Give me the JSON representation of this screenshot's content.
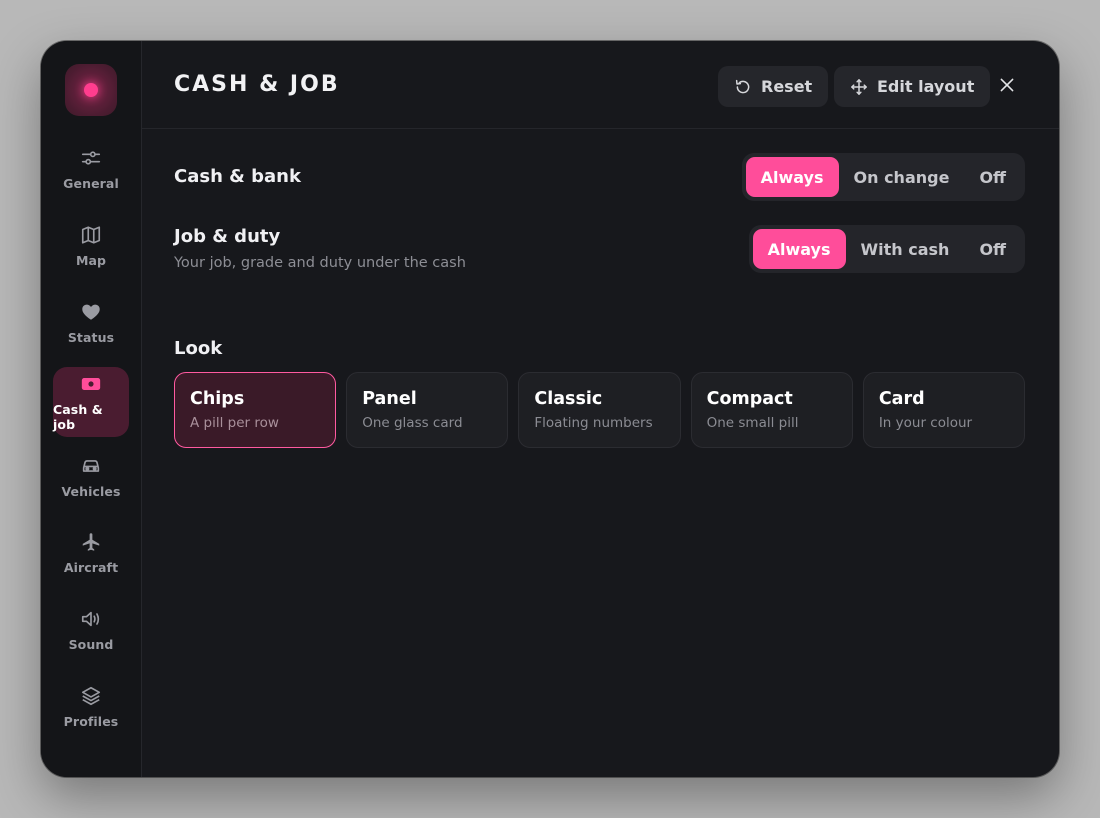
{
  "header": {
    "title": "CASH & JOB",
    "reset_label": "Reset",
    "edit_layout_label": "Edit layout"
  },
  "sidebar": {
    "items": [
      {
        "label": "General",
        "icon": "sliders-icon"
      },
      {
        "label": "Map",
        "icon": "map-icon"
      },
      {
        "label": "Status",
        "icon": "heart-icon"
      },
      {
        "label": "Cash & job",
        "icon": "cash-icon",
        "active": true
      },
      {
        "label": "Vehicles",
        "icon": "car-icon"
      },
      {
        "label": "Aircraft",
        "icon": "plane-icon"
      },
      {
        "label": "Sound",
        "icon": "speaker-icon"
      },
      {
        "label": "Profiles",
        "icon": "layers-icon"
      }
    ]
  },
  "settings": {
    "cash_bank": {
      "label": "Cash & bank",
      "options": [
        "Always",
        "On change",
        "Off"
      ],
      "selected": "Always"
    },
    "job_duty": {
      "label": "Job & duty",
      "description": "Your job, grade and duty under the cash",
      "options": [
        "Always",
        "With cash",
        "Off"
      ],
      "selected": "Always"
    },
    "look": {
      "label": "Look",
      "selected": "Chips",
      "cards": [
        {
          "title": "Chips",
          "subtitle": "A pill per row"
        },
        {
          "title": "Panel",
          "subtitle": "One glass card"
        },
        {
          "title": "Classic",
          "subtitle": "Floating numbers"
        },
        {
          "title": "Compact",
          "subtitle": "One small pill"
        },
        {
          "title": "Card",
          "subtitle": "In your colour"
        }
      ]
    }
  },
  "colors": {
    "accent": "#ff4d9a",
    "background": "#17181c",
    "sidebar_active": "#4a1c30"
  }
}
